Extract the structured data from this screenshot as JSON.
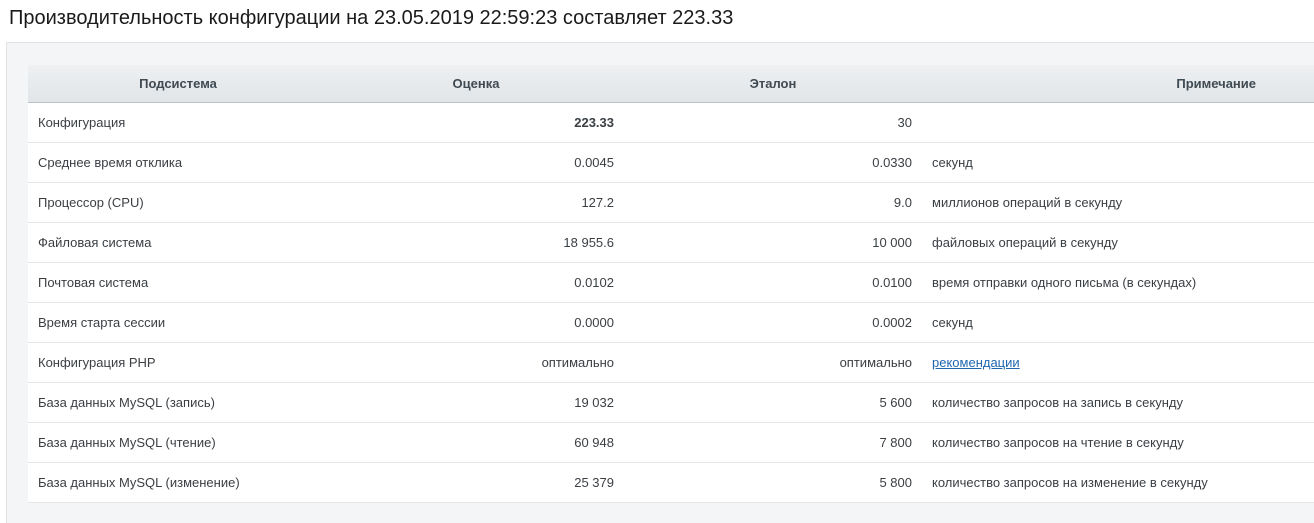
{
  "title": "Производительность конфигурации на 23.05.2019 22:59:23 составляет 223.33",
  "columns": {
    "subsystem": "Подсистема",
    "score": "Оценка",
    "reference": "Эталон",
    "note": "Примечание"
  },
  "rows": [
    {
      "subsystem": "Конфигурация",
      "score": "223.33",
      "reference": "30",
      "note": ""
    },
    {
      "subsystem": "Среднее время отклика",
      "score": "0.0045",
      "reference": "0.0330",
      "note": "секунд"
    },
    {
      "subsystem": "Процессор (CPU)",
      "score": "127.2",
      "reference": "9.0",
      "note": "миллионов операций в секунду"
    },
    {
      "subsystem": "Файловая система",
      "score": "18 955.6",
      "reference": "10 000",
      "note": "файловых операций в секунду"
    },
    {
      "subsystem": "Почтовая система",
      "score": "0.0102",
      "reference": "0.0100",
      "note": "время отправки одного письма (в секундах)"
    },
    {
      "subsystem": "Время старта сессии",
      "score": "0.0000",
      "reference": "0.0002",
      "note": "секунд"
    },
    {
      "subsystem": "Конфигурация PHP",
      "score": "оптимально",
      "reference": "оптимально",
      "note": "рекомендации"
    },
    {
      "subsystem": "База данных MySQL (запись)",
      "score": "19 032",
      "reference": "5 600",
      "note": "количество запросов на запись в секунду"
    },
    {
      "subsystem": "База данных MySQL (чтение)",
      "score": "60 948",
      "reference": "7 800",
      "note": "количество запросов на чтение в секунду"
    },
    {
      "subsystem": "База данных MySQL (изменение)",
      "score": "25 379",
      "reference": "5 800",
      "note": "количество запросов на изменение в секунду"
    }
  ],
  "colors": {
    "link": "#2067b0",
    "header_bg": "#e6e9ec",
    "panel_bg": "#f3f5f7"
  }
}
